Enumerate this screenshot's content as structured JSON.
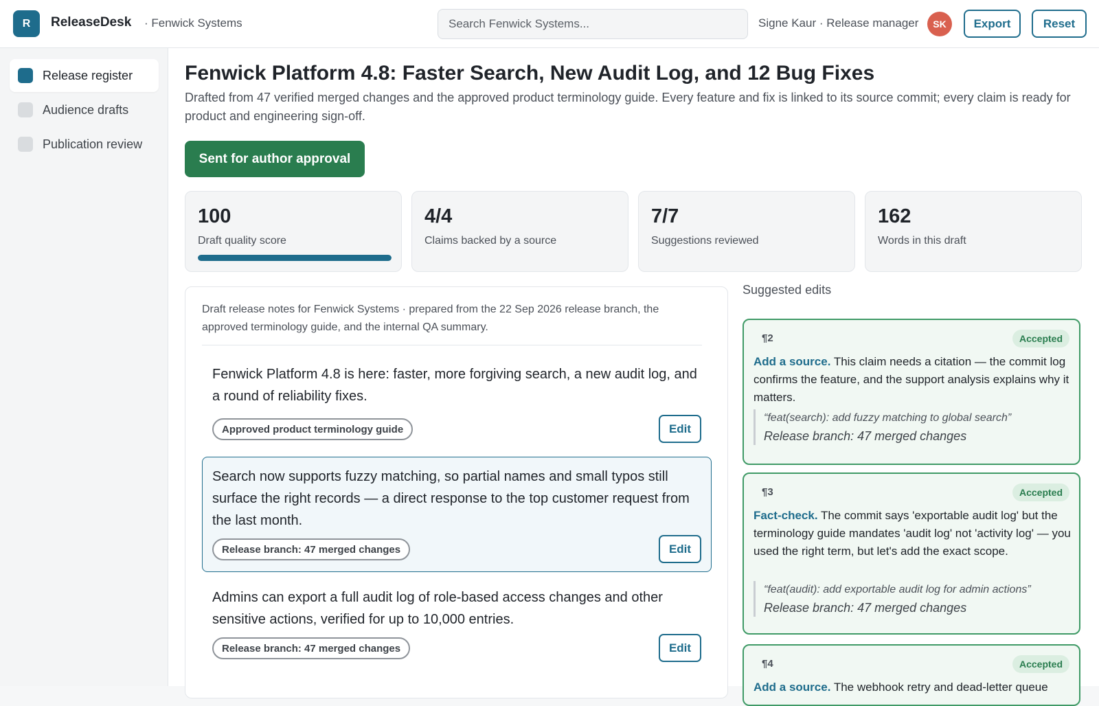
{
  "header": {
    "logo_letter": "R",
    "app_name": "ReleaseDesk",
    "org": "· Fenwick Systems",
    "search_placeholder": "Search Fenwick Systems...",
    "user": "Signe Kaur · Release manager",
    "avatar_initials": "SK",
    "export_label": "Export",
    "reset_label": "Reset"
  },
  "sidebar": {
    "items": [
      {
        "label": "Release register",
        "active": true
      },
      {
        "label": "Audience drafts",
        "active": false
      },
      {
        "label": "Publication review",
        "active": false
      }
    ]
  },
  "main": {
    "title": "Fenwick Platform 4.8: Faster Search, New Audit Log, and 12 Bug Fixes",
    "subtitle": "Drafted from 47 verified merged changes and the approved product terminology guide. Every feature and fix is linked to its source commit; every claim is ready for product and engineering sign-off.",
    "status_button": "Sent for author approval",
    "stats": [
      {
        "value": "100",
        "label": "Draft quality score",
        "progress": 1.0
      },
      {
        "value": "4/4",
        "label": "Claims backed by a source"
      },
      {
        "value": "7/7",
        "label": "Suggestions reviewed"
      },
      {
        "value": "162",
        "label": "Words in this draft"
      }
    ]
  },
  "draft": {
    "intro": "Draft release notes for Fenwick Systems · prepared from the 22 Sep 2026 release branch, the approved terminology guide, and the internal QA summary.",
    "edit_label": "Edit",
    "paragraphs": [
      {
        "text": "Fenwick Platform 4.8 is here: faster, more forgiving search, a new audit log, and a round of reliability fixes.",
        "source": "Approved product terminology guide"
      },
      {
        "text": "Search now supports fuzzy matching, so partial names and small typos still surface the right records — a direct response to the top customer request from the last month.",
        "source": "Release branch: 47 merged changes"
      },
      {
        "text": "Admins can export a full audit log of role-based access changes and other sensitive actions, verified for up to 10,000 entries.",
        "source": "Release branch: 47 merged changes"
      }
    ]
  },
  "suggestions": {
    "title": "Suggested edits",
    "items": [
      {
        "para": "¶2",
        "status": "Accepted",
        "kind": "Add a source.",
        "text": "This claim needs a citation — the commit log confirms the feature, and the support analysis explains why it matters.",
        "commit": "“feat(search): add fuzzy matching to global search”",
        "source": "Release branch: 47 merged changes"
      },
      {
        "para": "¶3",
        "status": "Accepted",
        "kind": "Fact-check.",
        "text": "The commit says 'exportable audit log' but the terminology guide mandates 'audit log' not 'activity log' — you used the right term, but let's add the exact scope.",
        "commit": "“feat(audit): add exportable audit log for admin actions”",
        "source": "Release branch: 47 merged changes"
      },
      {
        "para": "¶4",
        "status": "Accepted",
        "kind": "Add a source.",
        "text": "The webhook retry and dead-letter queue"
      }
    ]
  },
  "colors": {
    "accent": "#1e6c8c",
    "success": "#2a7d4f",
    "avatar": "#d9604f"
  }
}
